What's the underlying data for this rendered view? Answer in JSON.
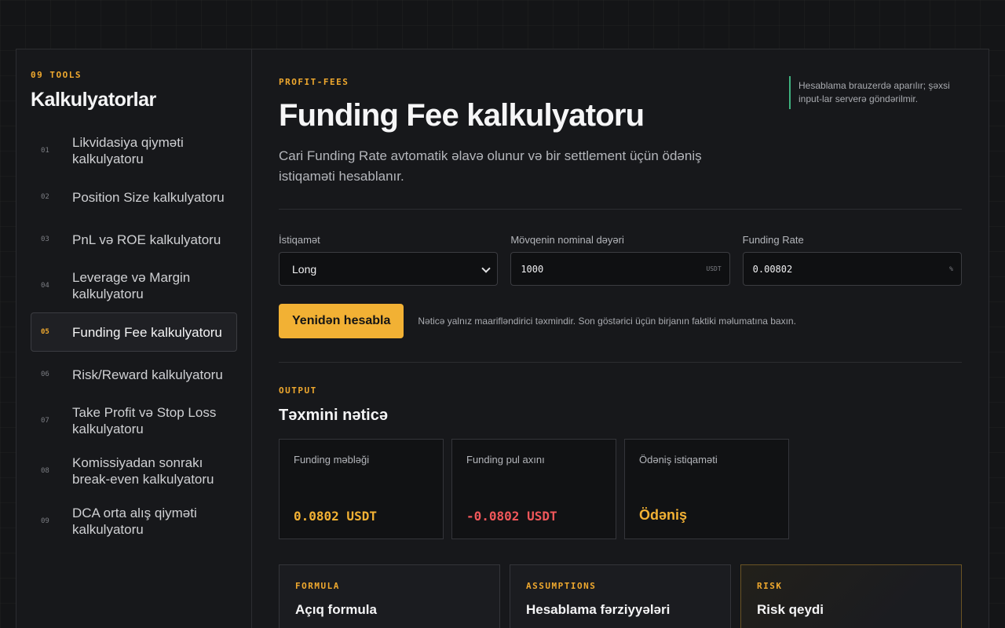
{
  "sidebar": {
    "eyebrow": "09 TOOLS",
    "title": "Kalkulyatorlar",
    "items": [
      {
        "num": "01",
        "label": "Likvidasiya qiyməti kalkulyatoru"
      },
      {
        "num": "02",
        "label": "Position Size kalkulyatoru"
      },
      {
        "num": "03",
        "label": "PnL və ROE kalkulyatoru"
      },
      {
        "num": "04",
        "label": "Leverage və Margin kalkulyatoru"
      },
      {
        "num": "05",
        "label": "Funding Fee kalkulyatoru",
        "active": true
      },
      {
        "num": "06",
        "label": "Risk/Reward kalkulyatoru"
      },
      {
        "num": "07",
        "label": "Take Profit və Stop Loss kalkulyatoru"
      },
      {
        "num": "08",
        "label": "Komissiyadan sonrakı break-even kalkulyatoru"
      },
      {
        "num": "09",
        "label": "DCA orta alış qiyməti kalkulyatoru"
      }
    ]
  },
  "header": {
    "eyebrow": "PROFIT-FEES",
    "title": "Funding Fee kalkulyatoru",
    "description": "Cari Funding Rate avtomatik əlavə olunur və bir settlement üçün ödəniş istiqaməti hesablanır.",
    "privacy_note": "Hesablama brauzerdə aparılır; şəxsi input-lar serverə göndərilmir."
  },
  "form": {
    "direction": {
      "label": "İstiqamət",
      "value": "Long"
    },
    "notional": {
      "label": "Mövqenin nominal dəyəri",
      "value": "1000",
      "unit": "USDT"
    },
    "funding_rate": {
      "label": "Funding Rate",
      "value": "0.00802",
      "unit": "%"
    },
    "recalc_button": "Yenidən hesabla",
    "hint": "Nəticə yalnız maarifləndirici təxmindir. Son göstərici üçün birjanın faktiki məlumatına baxın."
  },
  "output": {
    "eyebrow": "OUTPUT",
    "title": "Təxmini nəticə",
    "cards": [
      {
        "label": "Funding məbləği",
        "value": "0.0802 USDT",
        "color": "#f2b134"
      },
      {
        "label": "Funding pul axını",
        "value": "-0.0802 USDT",
        "color": "#f0575a"
      },
      {
        "label": "Ödəniş istiqaməti",
        "value": "Ödəniş",
        "color": "#f2b134"
      }
    ]
  },
  "info": [
    {
      "eyebrow": "FORMULA",
      "title": "Açıq formula"
    },
    {
      "eyebrow": "ASSUMPTIONS",
      "title": "Hesablama fərziyyələri"
    },
    {
      "eyebrow": "RISK",
      "title": "Risk qeydi"
    }
  ],
  "colors": {
    "accent": "#f2b134",
    "negative": "#f0575a",
    "note_border": "#3fb27f"
  }
}
